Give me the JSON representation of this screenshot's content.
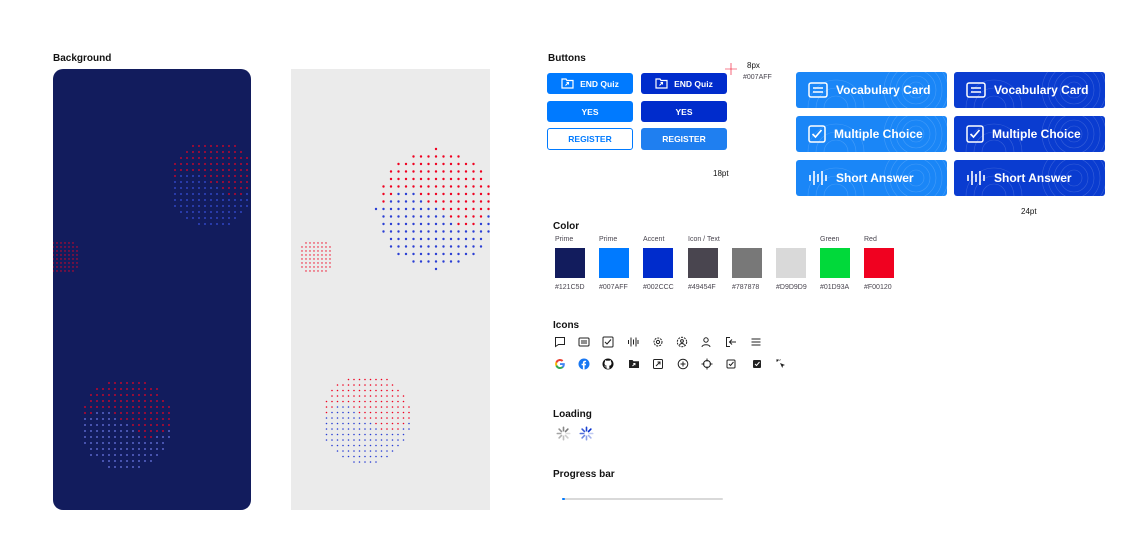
{
  "sections": {
    "background": "Background",
    "buttons": "Buttons",
    "color": "Color",
    "icons": "Icons",
    "loading": "Loading",
    "progress": "Progress bar"
  },
  "buttons": {
    "end_quiz": "END Quiz",
    "yes": "YES",
    "register": "REGISTER",
    "spacing_value": "8px",
    "spacing_color": "#007AFF",
    "small_size": "18pt",
    "large_size": "24pt"
  },
  "cards": {
    "vocabulary": "Vocabulary Card",
    "multiple_choice": "Multiple Choice",
    "short_answer": "Short Answer"
  },
  "colors": [
    {
      "label": "Prime",
      "hex": "#121C5D"
    },
    {
      "label": "Prime",
      "hex": "#007AFF"
    },
    {
      "label": "Accent",
      "hex": "#002CCC"
    },
    {
      "label": "Icon / Text",
      "hex": "#49454F"
    },
    {
      "label": "",
      "hex": "#787878"
    },
    {
      "label": "",
      "hex": "#D9D9D9"
    },
    {
      "label": "Green",
      "hex": "#01D93A"
    },
    {
      "label": "Red",
      "hex": "#F00120"
    }
  ],
  "icons_row1": [
    "chat-icon",
    "card-icon",
    "checkbox-icon",
    "soundwave-icon",
    "settings-icon",
    "user-settings-icon",
    "user-icon",
    "logout-icon",
    "menu-icon"
  ],
  "icons_row2": [
    "google-icon",
    "facebook-icon",
    "github-icon",
    "folder-share-icon",
    "share-box-icon",
    "add-circle-icon",
    "crosshair-icon",
    "checkbox-outline-icon",
    "checkbox-filled-icon",
    "cursor-click-icon"
  ],
  "theme": {
    "navy": "#121C5D",
    "prime": "#007AFF",
    "accent": "#002CCC",
    "red": "#F00120",
    "panel_light": "#EBEBEB"
  },
  "progress": {
    "value": 0.02
  }
}
